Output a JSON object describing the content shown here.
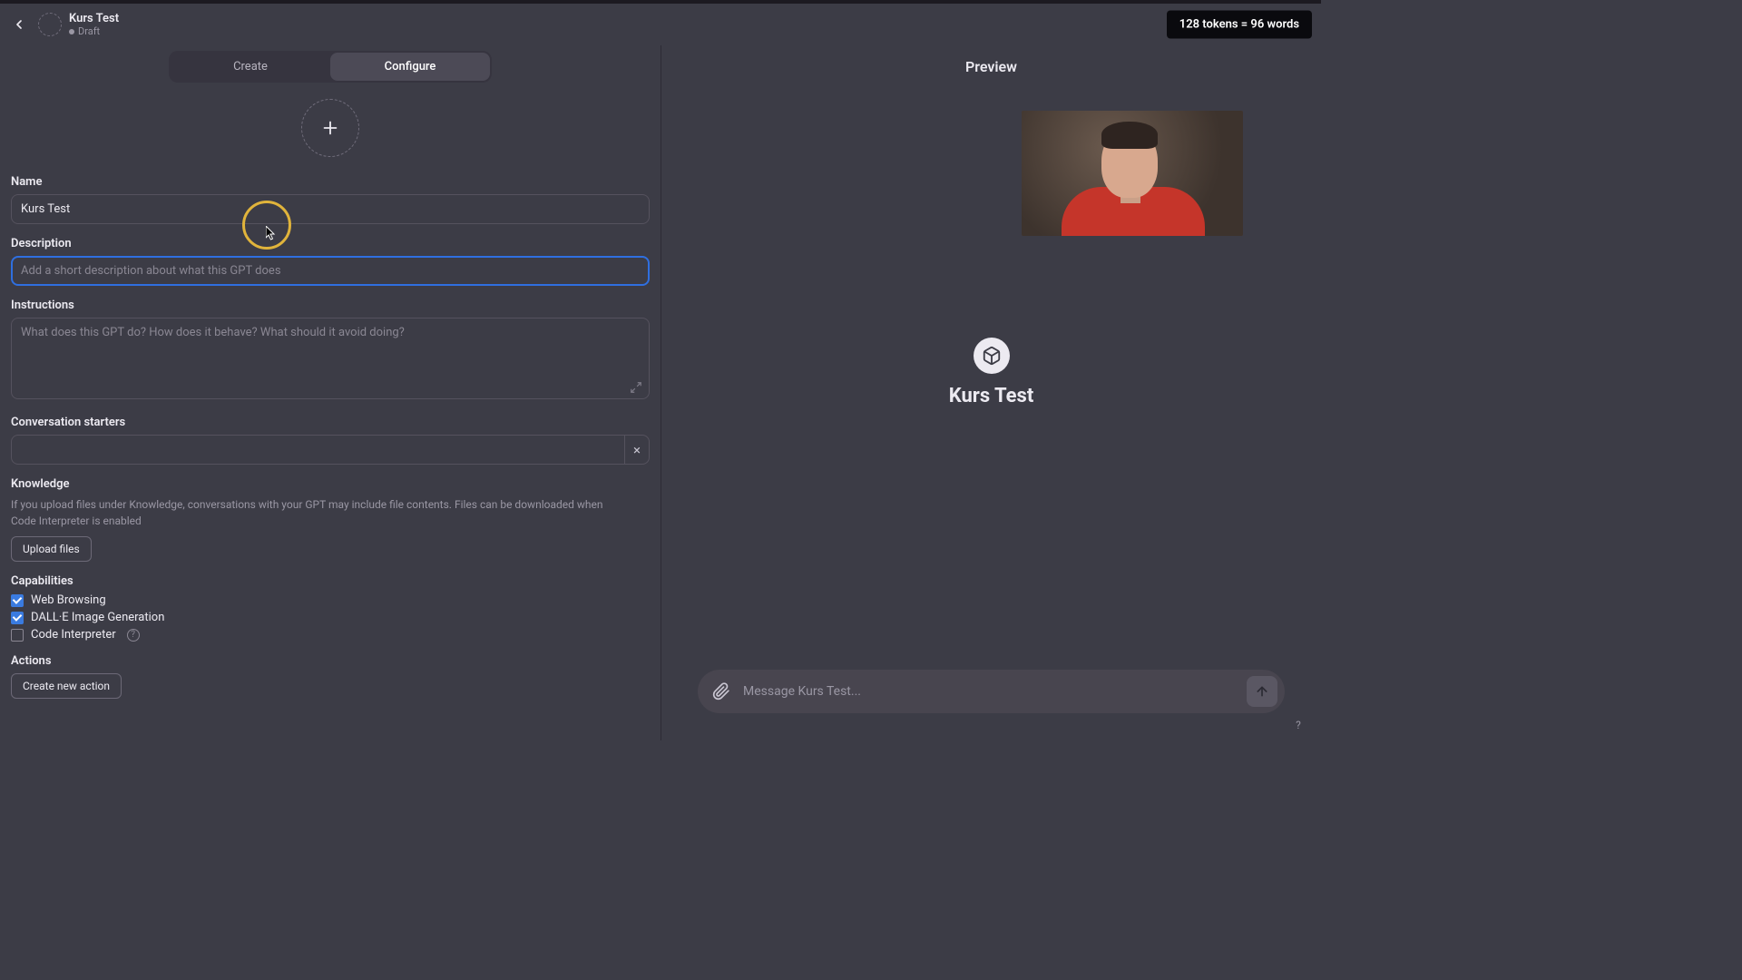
{
  "header": {
    "title": "Kurs Test",
    "status": "Draft",
    "token_badge": "128 tokens = 96 words"
  },
  "tabs": {
    "create": "Create",
    "configure": "Configure"
  },
  "form": {
    "name_label": "Name",
    "name_value": "Kurs Test",
    "desc_label": "Description",
    "desc_placeholder": "Add a short description about what this GPT does",
    "instr_label": "Instructions",
    "instr_placeholder": "What does this GPT do? How does it behave? What should it avoid doing?",
    "cs_label": "Conversation starters",
    "knowledge_label": "Knowledge",
    "knowledge_help": "If you upload files under Knowledge, conversations with your GPT may include file contents. Files can be downloaded when Code Interpreter is enabled",
    "upload_btn": "Upload files",
    "caps_label": "Capabilities",
    "cap_web": "Web Browsing",
    "cap_dalle": "DALL·E Image Generation",
    "cap_code": "Code Interpreter",
    "actions_label": "Actions",
    "new_action_btn": "Create new action"
  },
  "preview": {
    "title": "Preview",
    "gpt_name": "Kurs Test",
    "msg_placeholder": "Message Kurs Test...",
    "help": "?"
  }
}
